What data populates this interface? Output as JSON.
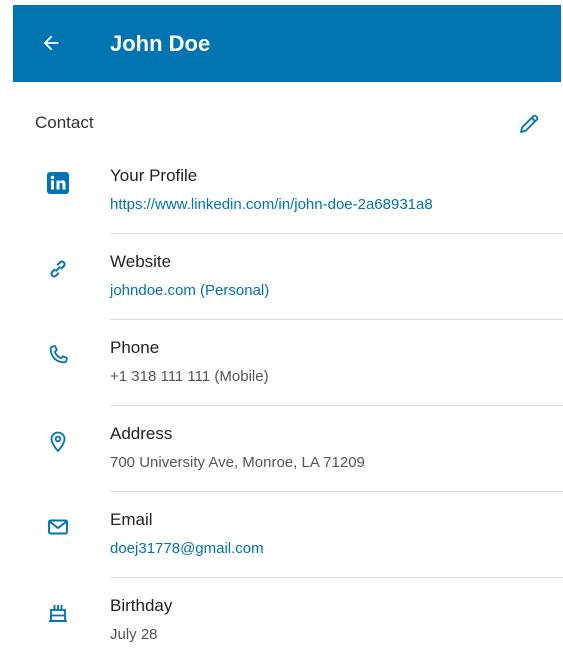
{
  "header": {
    "title": "John Doe",
    "back_icon": "arrow-left-icon",
    "color": "#0073b1"
  },
  "section": {
    "title": "Contact",
    "edit_icon": "pencil-icon"
  },
  "items": [
    {
      "id": "profile",
      "icon": "linkedin-icon",
      "label": "Your Profile",
      "value": "https://www.linkedin.com/in/john-doe-2a68931a8",
      "link": true
    },
    {
      "id": "website",
      "icon": "link-icon",
      "label": "Website",
      "value": "johndoe.com (Personal)",
      "link": true
    },
    {
      "id": "phone",
      "icon": "phone-icon",
      "label": "Phone",
      "value": "+1 318 111 111 (Mobile)",
      "link": false
    },
    {
      "id": "address",
      "icon": "location-pin-icon",
      "label": "Address",
      "value": "700 University Ave, Monroe, LA 71209",
      "link": false
    },
    {
      "id": "email",
      "icon": "envelope-icon",
      "label": "Email",
      "value": "doej31778@gmail.com",
      "link": true
    },
    {
      "id": "birthday",
      "icon": "cake-icon",
      "label": "Birthday",
      "value": "July 28",
      "link": false
    }
  ]
}
